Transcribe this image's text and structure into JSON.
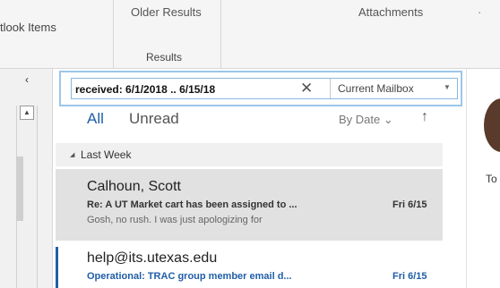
{
  "ribbon": {
    "outlook_items": "tlook Items",
    "older_results": "Older Results",
    "results_group": "Results",
    "attachments": "Attachments",
    "dot": "·"
  },
  "nav": {
    "collapse_glyph": "‹"
  },
  "search": {
    "query": "received: 6/1/2018 .. 6/15/18",
    "clear_glyph": "✕",
    "scope": "Current Mailbox",
    "scope_caret": "▼"
  },
  "filters": {
    "all": "All",
    "unread": "Unread",
    "sort": "By Date ⌄",
    "sort_arrow": "↑"
  },
  "group": {
    "label": "Last Week",
    "triangle": "◢"
  },
  "messages": [
    {
      "sender": "Calhoun, Scott",
      "subject": "Re: A UT Market cart has been assigned to ...",
      "preview": "Gosh, no rush. I was just apologizing for",
      "date": "Fri 6/15"
    },
    {
      "sender": "help@its.utexas.edu",
      "subject": "Operational: TRAC group member email d...",
      "date": "Fri 6/15"
    }
  ],
  "reading": {
    "to_label": "To"
  },
  "colors": {
    "accent": "#1f5ea8",
    "selected": "#e1e1e1",
    "search_border": "#9cc6ea"
  }
}
